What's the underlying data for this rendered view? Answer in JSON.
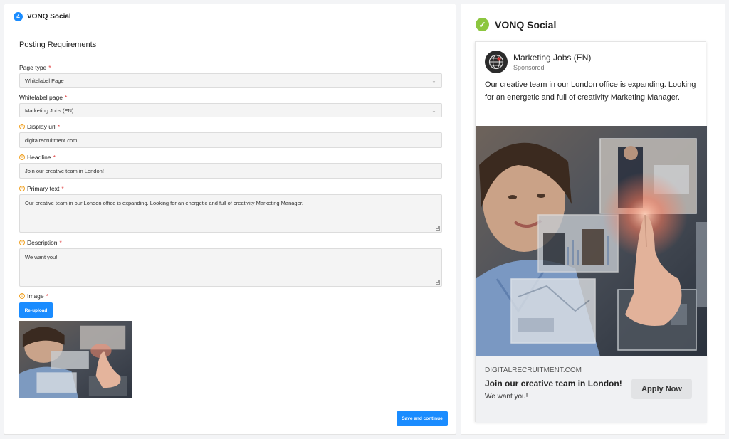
{
  "left": {
    "step_number": "4",
    "step_title": "VONQ Social",
    "section_title": "Posting Requirements",
    "fields": {
      "page_type": {
        "label": "Page type",
        "required": "*",
        "value": "Whitelabel Page"
      },
      "whitelabel_page": {
        "label": "Whitelabel page",
        "required": "*",
        "value": "Marketing Jobs (EN)"
      },
      "display_url": {
        "label": "Display url",
        "required": "*",
        "value": "digitalrecruitment.com"
      },
      "headline": {
        "label": "Headline",
        "required": "*",
        "value": "Join our creative team in London!"
      },
      "primary_text": {
        "label": "Primary text",
        "required": "*",
        "value": "Our creative team in our London office is expanding. Looking for an energetic and full of creativity Marketing Manager."
      },
      "description": {
        "label": "Description",
        "required": "*",
        "value": "We want you!"
      },
      "image": {
        "label": "Image",
        "required": "*"
      }
    },
    "reupload_label": "Re-upload",
    "save_label": "Save and continue"
  },
  "right": {
    "title": "VONQ Social",
    "card": {
      "page_name": "Marketing Jobs (EN)",
      "sponsored": "Sponsored",
      "primary_text": "Our creative team in our London office is expanding. Looking for an energetic and full of creativity Marketing Manager.",
      "display_url": "DIGITALRECRUITMENT.COM",
      "headline": "Join our creative team in London!",
      "description": "We want you!",
      "cta_label": "Apply Now"
    }
  },
  "colors": {
    "primary": "#1a8cff",
    "success": "#8cc63f",
    "required": "#e04040",
    "warning": "#f0a020"
  }
}
